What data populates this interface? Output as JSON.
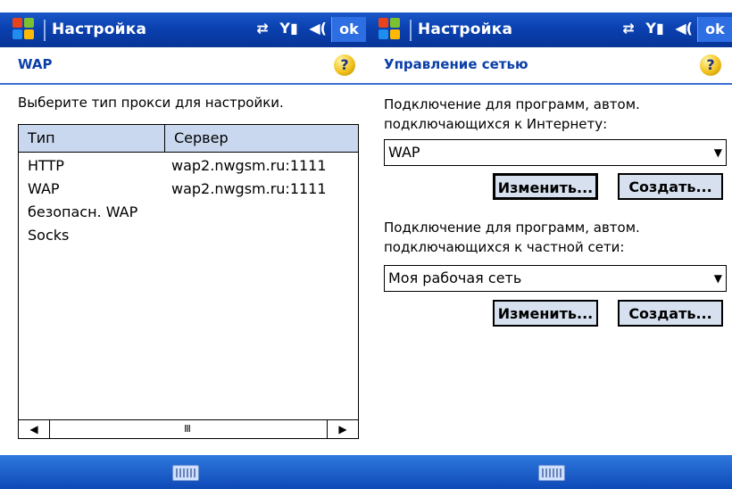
{
  "left": {
    "title": "Настройка",
    "ok_label": "ok",
    "heading": "WAP",
    "help_icon": "?",
    "prompt": "Выберите тип прокси для настройки.",
    "list": {
      "columns": [
        "Тип",
        "Сервер"
      ],
      "rows": [
        {
          "type": "HTTP",
          "server": "wap2.nwgsm.ru:1111"
        },
        {
          "type": "WAP",
          "server": "wap2.nwgsm.ru:1111"
        },
        {
          "type": "безопасн. WAP",
          "server": ""
        },
        {
          "type": "Socks",
          "server": ""
        }
      ],
      "scroll_left": "◀",
      "scroll_thumb": "III",
      "scroll_right": "▶"
    }
  },
  "right": {
    "title": "Настройка",
    "ok_label": "ok",
    "heading": "Управление сетью",
    "help_icon": "?",
    "internet_label_1": "Подключение для программ, автом.",
    "internet_label_2": "подключающихся к Интернету:",
    "internet_value": "WAP",
    "private_label_1": "Подключение для программ, автом.",
    "private_label_2": "подключающихся к частной сети:",
    "private_value": "Моя рабочая сеть",
    "edit_label": "Изменить...",
    "create_label": "Создать..."
  },
  "status_icons": [
    "sync-icon",
    "signal-icon",
    "speaker-icon"
  ],
  "colors": {
    "titlebar": "#0a40b0",
    "heading_text": "#0b3fa8",
    "list_header": "#c9d8ef"
  }
}
